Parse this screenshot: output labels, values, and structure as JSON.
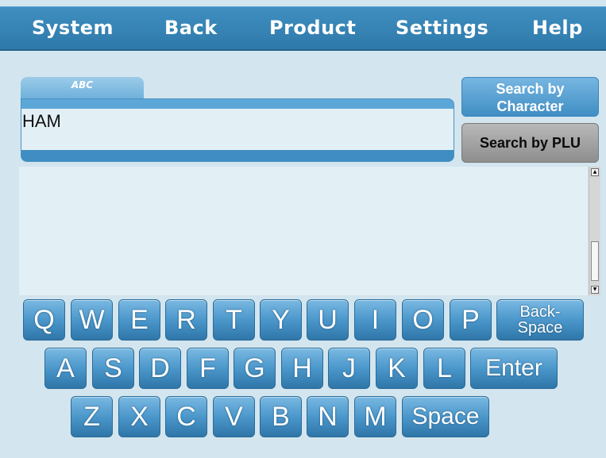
{
  "menu": {
    "items": [
      "System",
      "Back",
      "Product",
      "Settings",
      "Help"
    ]
  },
  "entry": {
    "tab_label": "ABC",
    "value": "HAM"
  },
  "search": {
    "by_character_line1": "Search by",
    "by_character_line2": "Character",
    "by_plu": "Search by PLU"
  },
  "results": [],
  "keyboard": {
    "row1": [
      "Q",
      "W",
      "E",
      "R",
      "T",
      "Y",
      "U",
      "I",
      "O",
      "P"
    ],
    "backspace_line1": "Back-",
    "backspace_line2": "Space",
    "row2": [
      "A",
      "S",
      "D",
      "F",
      "G",
      "H",
      "J",
      "K",
      "L"
    ],
    "enter": "Enter",
    "row3": [
      "Z",
      "X",
      "C",
      "V",
      "B",
      "N",
      "M"
    ],
    "space": "Space"
  },
  "colors": {
    "menubar": "#3585b8",
    "background": "#d3e5ee",
    "key": "#4b97cb",
    "plu_button": "#a3a3a3"
  }
}
